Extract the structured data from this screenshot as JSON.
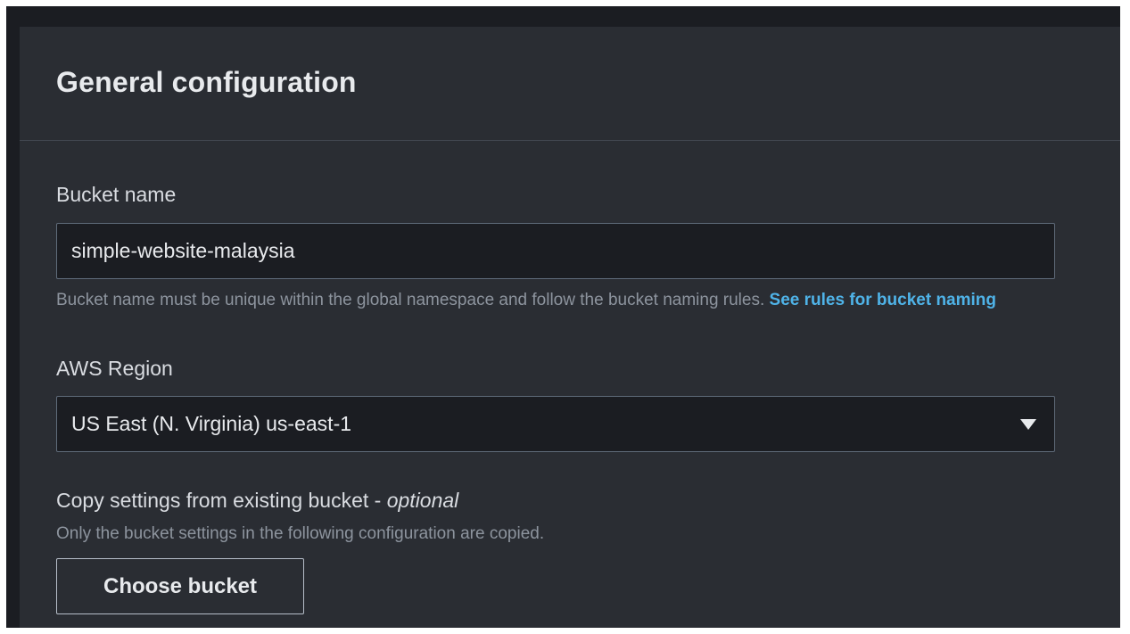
{
  "panel": {
    "title": "General configuration"
  },
  "bucket_name": {
    "label": "Bucket name",
    "value": "simple-website-malaysia",
    "help_text": "Bucket name must be unique within the global namespace and follow the bucket naming rules.",
    "help_link": "See rules for bucket naming"
  },
  "region": {
    "label": "AWS Region",
    "selected": "US East (N. Virginia) us-east-1",
    "icon": "caret-down-icon"
  },
  "copy_settings": {
    "label": "Copy settings from existing bucket - ",
    "label_optional": "optional",
    "help_text": "Only the bucket settings in the following configuration are copied.",
    "button_label": "Choose bucket"
  },
  "colors": {
    "background": "#1b1d22",
    "panel": "#2a2d33",
    "link": "#4fb3e8",
    "input_border": "#5f6b7a"
  }
}
